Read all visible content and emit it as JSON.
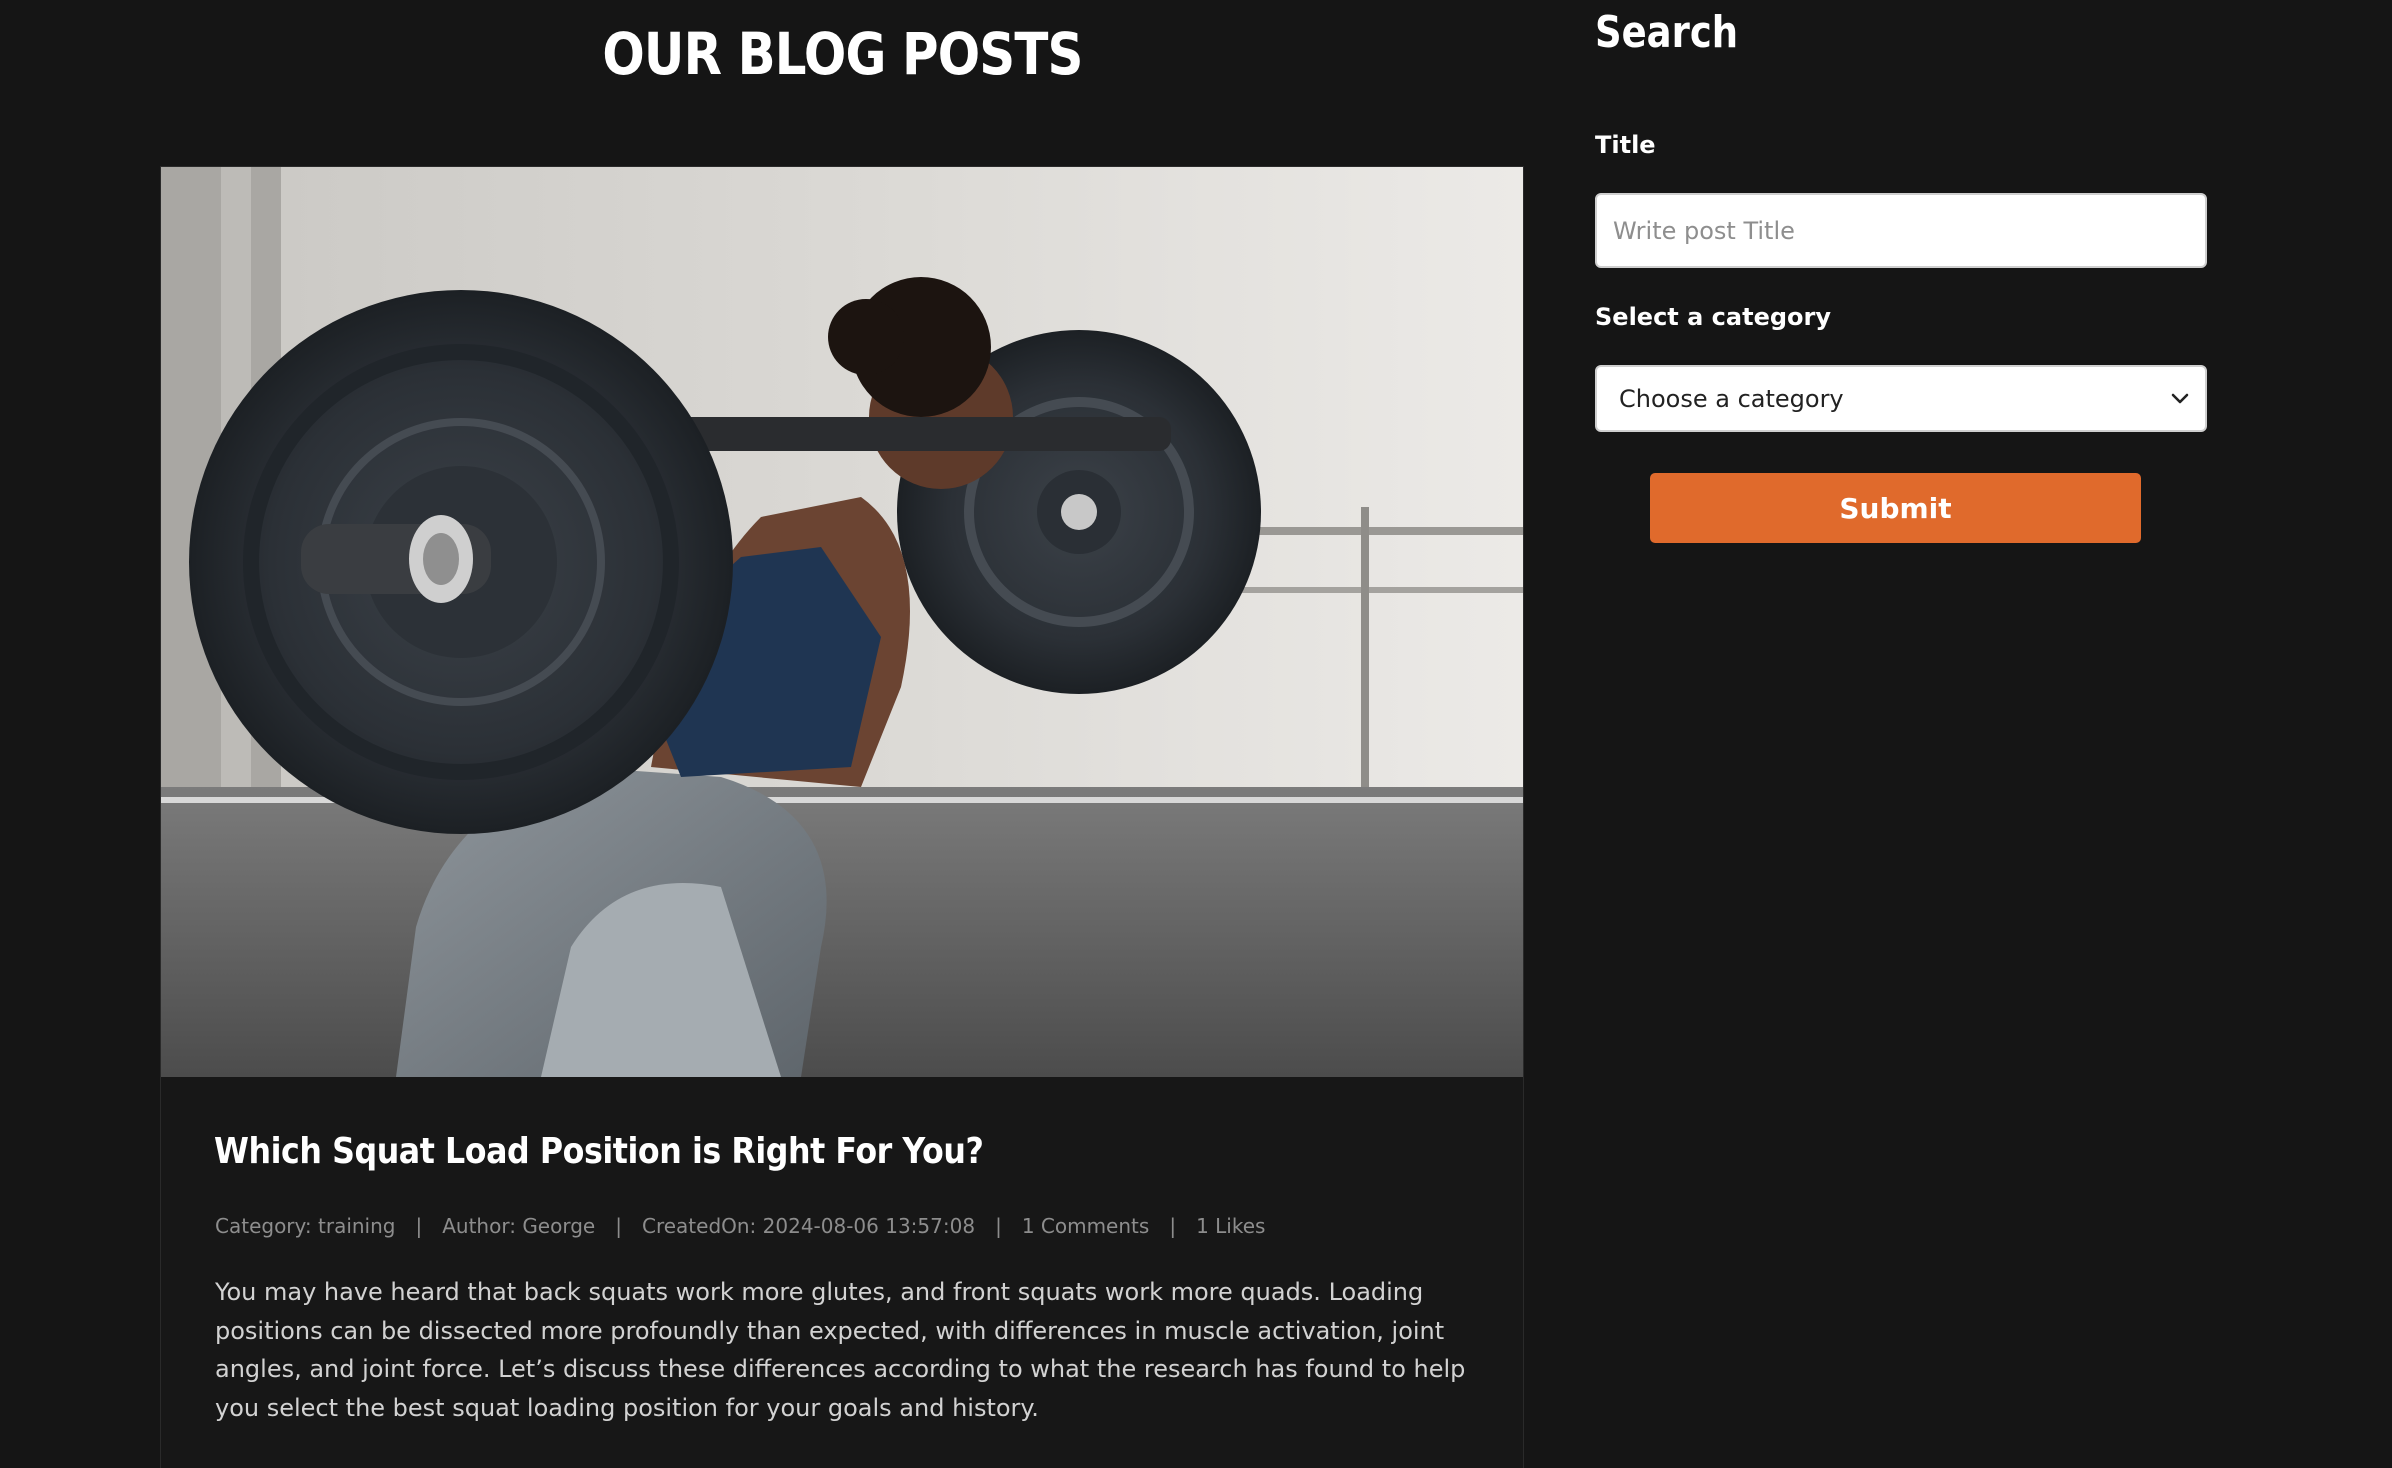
{
  "blog": {
    "heading": "OUR BLOG POSTS"
  },
  "post": {
    "image_alt": "Woman performing a barbell back squat in a gym",
    "title": "Which Squat Load Position is Right For You?",
    "meta": {
      "category": "Category: training",
      "author": "Author: George",
      "created_on": "CreatedOn: 2024-08-06 13:57:08",
      "comments": "1 Comments",
      "likes": "1 Likes",
      "separator": "|"
    },
    "excerpt": "You may have heard that back squats work more glutes, and front squats work more quads. Loading positions can be dissected more profoundly than expected, with differences in muscle activation, joint angles, and joint force. Let’s discuss these differences according to what the research has found to help you select the best squat loading position for your goals and history."
  },
  "sidebar": {
    "heading": "Search",
    "title_label": "Title",
    "title_placeholder": "Write post Title",
    "title_value": "",
    "category_label": "Select a category",
    "category_selected": "Choose a category",
    "submit_label": "Submit"
  },
  "colors": {
    "background": "#151515",
    "accent": "#e06a2c",
    "text": "#ffffff",
    "muted": "#8d8d8d"
  },
  "icons": {
    "select_chevron": "chevron-down-icon"
  }
}
